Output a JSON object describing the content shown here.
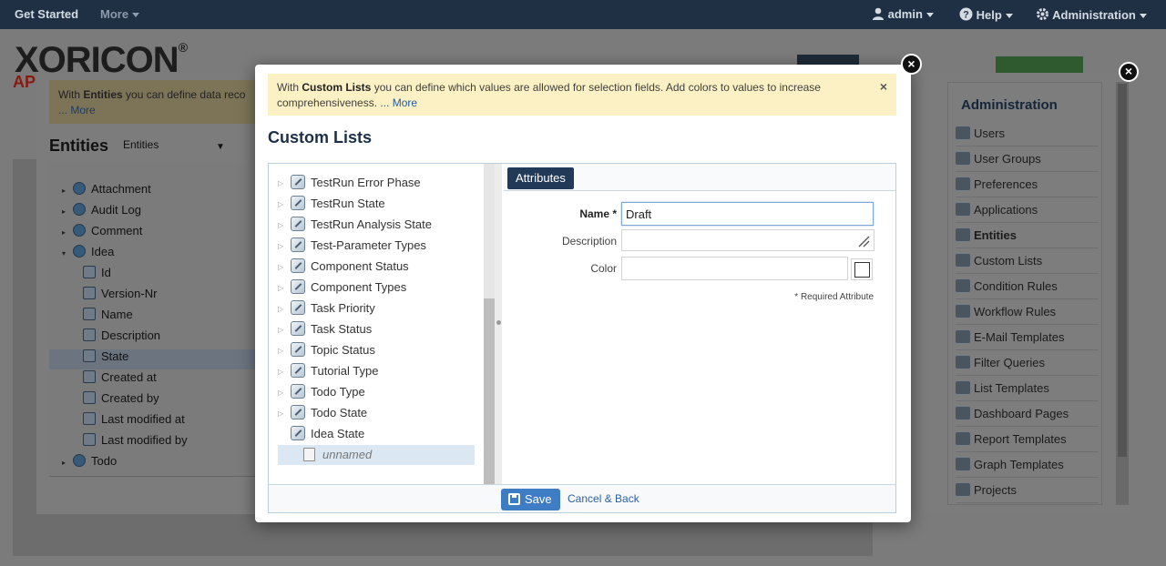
{
  "topnav": {
    "get_started": "Get Started",
    "more": "More",
    "admin": "admin",
    "help": "Help",
    "administration": "Administration"
  },
  "brand": {
    "logo": "XORICON",
    "reg": "®",
    "sub": "AP"
  },
  "entities_dialog": {
    "info_bold": "Entities",
    "info_text": " you can define data reco",
    "info_more": "... More",
    "title": "Entities",
    "selector": "Entities",
    "tree": [
      {
        "label": "Attachment",
        "kind": "entity",
        "level": 0,
        "expander": "▸"
      },
      {
        "label": "Audit Log",
        "kind": "entity",
        "level": 0,
        "expander": "▸"
      },
      {
        "label": "Comment",
        "kind": "entity",
        "level": 0,
        "expander": "▸"
      },
      {
        "label": "Idea",
        "kind": "entity",
        "level": 0,
        "expander": "▾"
      },
      {
        "label": "Id",
        "kind": "attr",
        "level": 1
      },
      {
        "label": "Version-Nr",
        "kind": "attr",
        "level": 1
      },
      {
        "label": "Name",
        "kind": "attr",
        "level": 1
      },
      {
        "label": "Description",
        "kind": "attr",
        "level": 1
      },
      {
        "label": "State",
        "kind": "attr",
        "level": 1,
        "selected": true
      },
      {
        "label": "Created at",
        "kind": "attr",
        "level": 1
      },
      {
        "label": "Created by",
        "kind": "attr",
        "level": 1
      },
      {
        "label": "Last modified at",
        "kind": "attr",
        "level": 1
      },
      {
        "label": "Last modified by",
        "kind": "attr",
        "level": 1
      },
      {
        "label": "Todo",
        "kind": "entity",
        "level": 0,
        "expander": "▸"
      }
    ]
  },
  "admin_sidebar": {
    "title": "Administration",
    "items": [
      {
        "label": "Users",
        "icon": "user-icon"
      },
      {
        "label": "User Groups",
        "icon": "user-group-icon"
      },
      {
        "label": "Preferences",
        "icon": "wrench-icon"
      },
      {
        "label": "Applications",
        "icon": "window-icon"
      },
      {
        "label": "Entities",
        "icon": "gear-icon",
        "active": true
      },
      {
        "label": "Custom Lists",
        "icon": "list-wrench-icon"
      },
      {
        "label": "Condition Rules",
        "icon": "condition-icon"
      },
      {
        "label": "Workflow Rules",
        "icon": "workflow-icon"
      },
      {
        "label": "E-Mail Templates",
        "icon": "envelope-icon"
      },
      {
        "label": "Filter Queries",
        "icon": "filter-icon"
      },
      {
        "label": "List Templates",
        "icon": "list-icon"
      },
      {
        "label": "Dashboard Pages",
        "icon": "dashboard-icon"
      },
      {
        "label": "Report Templates",
        "icon": "report-icon"
      },
      {
        "label": "Graph Templates",
        "icon": "pie-chart-icon"
      },
      {
        "label": "Projects",
        "icon": "project-icon"
      }
    ]
  },
  "custom_lists": {
    "info_prefix": "With ",
    "info_bold": "Custom Lists",
    "info_text": " you can define which values are allowed for selection fields. Add colors to values to increase comprehensiveness. ",
    "info_more": "... More",
    "info_close": "×",
    "title": "Custom Lists",
    "lists": [
      {
        "label": "TestRun Error Phase",
        "expander": "▷"
      },
      {
        "label": "TestRun State",
        "expander": "▷"
      },
      {
        "label": "TestRun Analysis State",
        "expander": "▷"
      },
      {
        "label": "Test-Parameter Types",
        "expander": "▷"
      },
      {
        "label": "Component Status",
        "expander": "▷"
      },
      {
        "label": "Component Types",
        "expander": "▷"
      },
      {
        "label": "Task Priority",
        "expander": "▷"
      },
      {
        "label": "Task Status",
        "expander": "▷"
      },
      {
        "label": "Topic Status",
        "expander": "▷"
      },
      {
        "label": "Tutorial Type",
        "expander": "▷"
      },
      {
        "label": "Todo Type",
        "expander": "▷"
      },
      {
        "label": "Todo State",
        "expander": "▷"
      },
      {
        "label": "Idea State",
        "expander": ""
      }
    ],
    "selected_value": "unnamed",
    "tab_attributes": "Attributes",
    "form": {
      "name_label": "Name *",
      "name_value": "Draft",
      "description_label": "Description",
      "description_value": "",
      "color_label": "Color",
      "color_value": "",
      "required_note": "* Required Attribute"
    },
    "save_label": "Save",
    "cancel_label": "Cancel & Back"
  }
}
